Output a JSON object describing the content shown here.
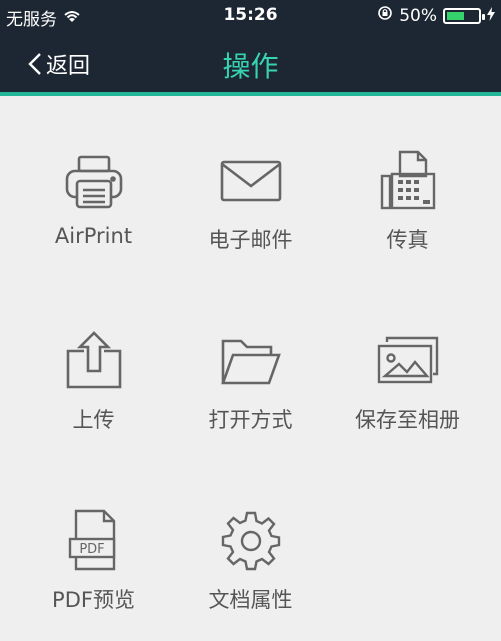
{
  "status": {
    "carrier": "无服务",
    "time": "15:26",
    "battery_text": "50%"
  },
  "nav": {
    "back_label": "返回",
    "title": "操作"
  },
  "colors": {
    "nav_bg": "#1d2733",
    "accent": "#23b79a",
    "title": "#37d3b0"
  },
  "items": [
    {
      "label": "AirPrint",
      "icon": "printer-icon"
    },
    {
      "label": "电子邮件",
      "icon": "mail-icon"
    },
    {
      "label": "传真",
      "icon": "fax-icon"
    },
    {
      "label": "上传",
      "icon": "upload-icon"
    },
    {
      "label": "打开方式",
      "icon": "folder-icon"
    },
    {
      "label": "保存至相册",
      "icon": "photo-album-icon"
    },
    {
      "label": "PDF预览",
      "icon": "pdf-preview-icon"
    },
    {
      "label": "文档属性",
      "icon": "gear-icon"
    }
  ],
  "pdf_icon_text": "PDF"
}
